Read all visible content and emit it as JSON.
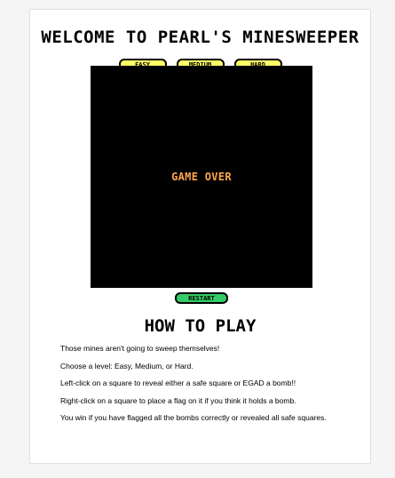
{
  "header": {
    "title": "Welcome to Pearl's Minesweeper"
  },
  "levels": {
    "easy_label": "Easy",
    "medium_label": "Medium",
    "hard_label": "Hard"
  },
  "board": {
    "status": "Game Over"
  },
  "controls": {
    "restart_label": "Restart"
  },
  "how_to_play": {
    "title": "How to Play",
    "instructions": [
      "Those mines aren't going to sweep themselves!",
      "Choose a level: Easy, Medium, or Hard.",
      "Left-click on a square to reveal either a safe square or EGAD a bomb!!",
      "Right-click on a square to place a flag on it if you think it holds a bomb.",
      "You win if you have flagged all the bombs correctly or revealed all safe squares."
    ]
  },
  "colors": {
    "level_button_bg": "#ffff66",
    "restart_button_bg": "#33cc66",
    "game_over_text": "#ffa64d",
    "board_bg": "#000000"
  }
}
